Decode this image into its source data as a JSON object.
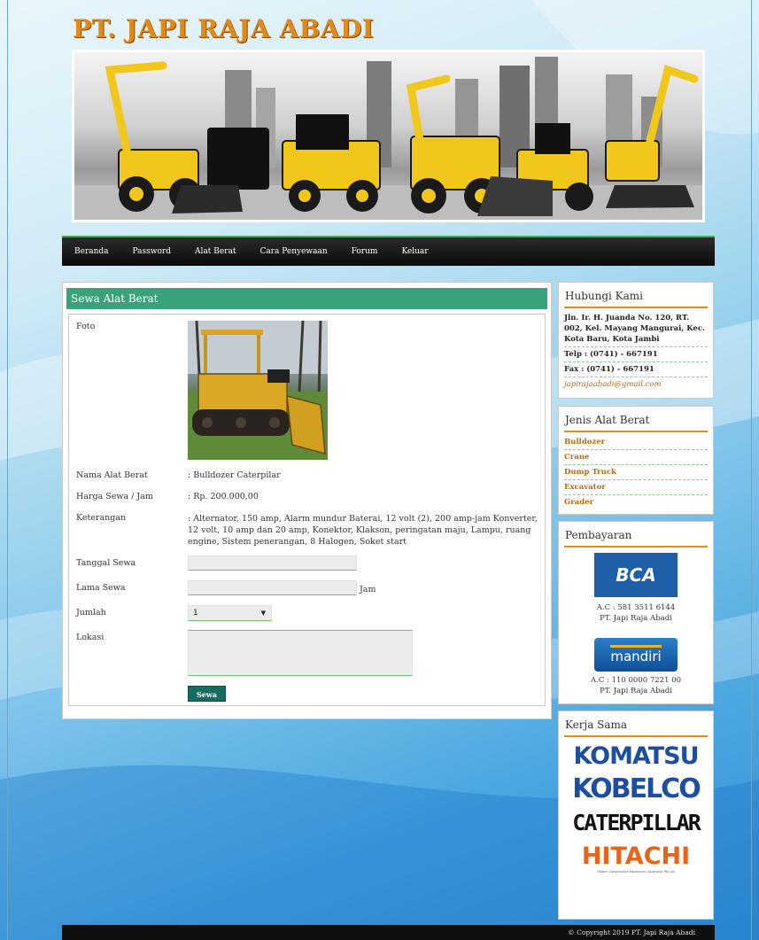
{
  "site": {
    "title": "PT. JAPI RAJA ABADI"
  },
  "nav": {
    "items": [
      {
        "label": "Beranda"
      },
      {
        "label": "Password"
      },
      {
        "label": "Alat Berat"
      },
      {
        "label": "Cara Penyewaan"
      },
      {
        "label": "Forum"
      },
      {
        "label": "Keluar"
      }
    ]
  },
  "main": {
    "header": "Sewa Alat Berat",
    "labels": {
      "foto": "Foto",
      "nama": "Nama Alat Berat",
      "harga": "Harga Sewa / Jam",
      "keterangan": "Keterangan",
      "tanggal": "Tanggal Sewa",
      "lama": "Lama Sewa",
      "jumlah": "Jumlah",
      "lokasi": "Lokasi"
    },
    "values": {
      "nama": ": Bulldozer Caterpilar",
      "harga": ": Rp. 200.000,00",
      "keterangan": ": Alternator, 150 amp, Alarm mundur Baterai, 12 volt (2), 200 amp-jam Konverter, 12 volt, 10 amp dan 20 amp, Konektor, Klakson, peringatan maju, Lampu, ruang engine, Sistem penerangan, 8 Halogen, Soket start"
    },
    "inputs": {
      "tanggal_value": "",
      "lama_value": "",
      "lama_unit": "Jam",
      "jumlah_selected": "1",
      "lokasi_value": ""
    },
    "submit_label": "Sewa"
  },
  "sidebar": {
    "contact": {
      "title": "Hubungi Kami",
      "address": "Jln. Ir. H. Juanda No. 120, RT. 002, Kel. Mayang Mangurai, Kec. Kota Baru, Kota Jambi",
      "phone": "Telp : (0741) - 667191",
      "fax": "Fax : (0741) - 667191",
      "email": "japirajaabadi@gmail.com"
    },
    "categories": {
      "title": "Jenis Alat Berat",
      "items": [
        "Bulldozer",
        "Crane",
        "Dump Truck",
        "Excavator",
        "Grader"
      ]
    },
    "payment": {
      "title": "Pembayaran",
      "bca": {
        "logo_text": "BCA",
        "account": "A.C : 581 3511 6144",
        "holder": "PT. Japi Raja Abadi"
      },
      "mandiri": {
        "logo_text": "mandiri",
        "account": "A.C : 110 0000 7221 00",
        "holder": "PT. Japi Raja Abadi"
      }
    },
    "partners": {
      "title": "Kerja Sama",
      "items": [
        "KOMATSU",
        "KOBELCO",
        "CATERPILLAR",
        "HITACHI"
      ],
      "hitachi_sub": "Hitachi Construction Machinery (Australia) Pty Ltd"
    }
  },
  "footer": {
    "copyright": "© Copyright 2019 PT. Japi Raja Abadi"
  },
  "colors": {
    "accent_orange": "#e08a17",
    "header_green": "#3aa27a",
    "button_teal": "#176b5f",
    "nav_bg": "#0b0b0b"
  }
}
